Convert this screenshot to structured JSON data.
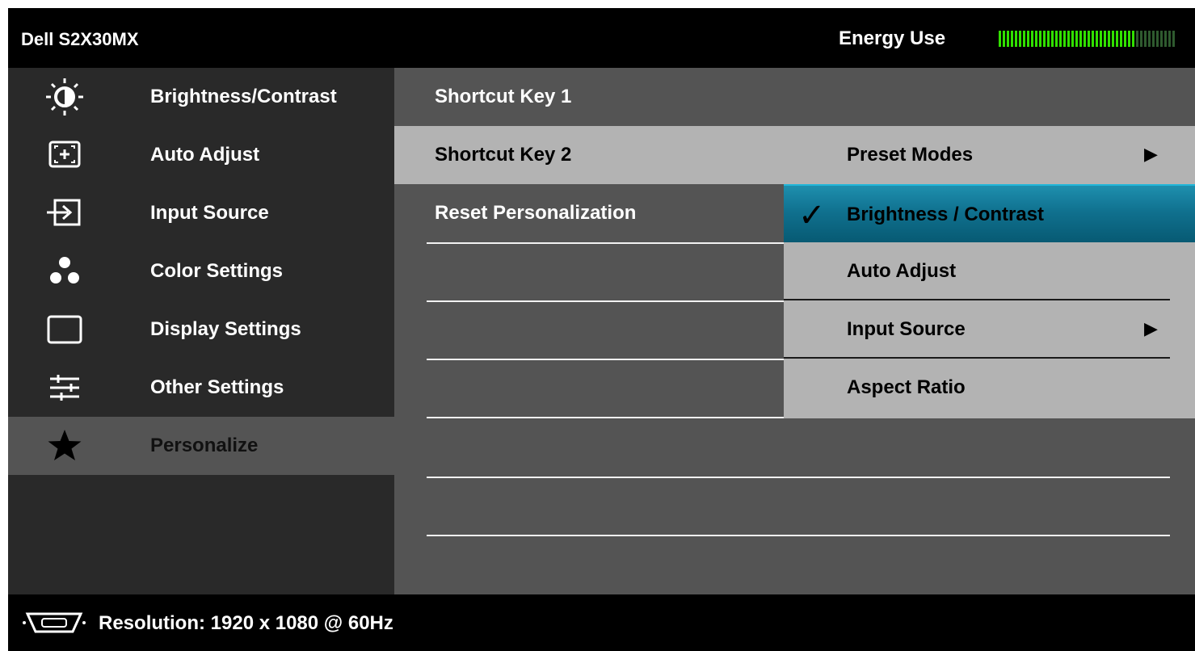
{
  "header": {
    "title": "Dell S2X30MX",
    "energy_label": "Energy Use",
    "energy_level": 0.77,
    "energy_colors": {
      "on": "#31e000",
      "off": "#2f5a2f"
    }
  },
  "sidebar": {
    "items": [
      {
        "label": "Brightness/Contrast",
        "icon": "brightness-icon"
      },
      {
        "label": "Auto Adjust",
        "icon": "auto-adjust-icon"
      },
      {
        "label": "Input Source",
        "icon": "input-source-icon"
      },
      {
        "label": "Color Settings",
        "icon": "color-settings-icon"
      },
      {
        "label": "Display Settings",
        "icon": "display-settings-icon"
      },
      {
        "label": "Other Settings",
        "icon": "other-settings-icon"
      },
      {
        "label": "Personalize",
        "icon": "star-icon",
        "active": true
      }
    ]
  },
  "personalize": {
    "items": [
      {
        "label": "Shortcut Key 1"
      },
      {
        "label": "Shortcut Key 2",
        "selected": true
      },
      {
        "label": "Reset Personalization"
      }
    ]
  },
  "submenu": {
    "items": [
      {
        "label": "Preset Modes",
        "has_arrow": true
      },
      {
        "label": "Brightness / Contrast",
        "checked": true,
        "highlight": true
      },
      {
        "label": "Auto Adjust"
      },
      {
        "label": "Input Source",
        "has_arrow": true
      },
      {
        "label": "Aspect Ratio"
      }
    ],
    "check_glyph": "✓",
    "arrow_glyph": "▶"
  },
  "footer": {
    "resolution": "Resolution: 1920 x 1080 @ 60Hz",
    "icon": "vga-connector-icon"
  },
  "colors": {
    "highlight": "#10718f",
    "panel": "#545454",
    "sidebar": "#292929",
    "selected": "#b3b3b3"
  }
}
